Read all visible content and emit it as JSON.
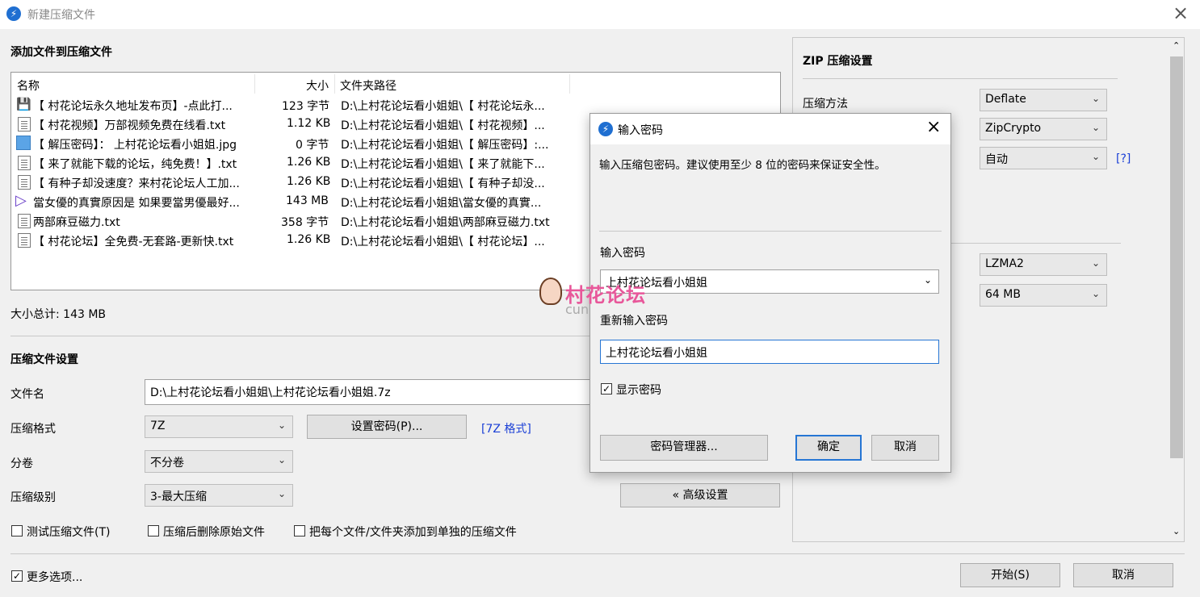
{
  "window": {
    "title": "新建压缩文件",
    "close_icon": "×"
  },
  "files_section": {
    "title": "添加文件到压缩文件",
    "columns": {
      "name": "名称",
      "size": "大小",
      "path": "文件夹路径"
    },
    "rows": [
      {
        "icon": "floppy-icon",
        "name": "【 村花论坛永久地址发布页】-点此打...",
        "size": "123 字节",
        "path": "D:\\上村花论坛看小姐姐\\【 村花论坛永..."
      },
      {
        "icon": "text-file-icon",
        "name": "【 村花视频】万部视频免费在线看.txt",
        "size": "1.12 KB",
        "path": "D:\\上村花论坛看小姐姐\\【 村花视频】..."
      },
      {
        "icon": "image-file-icon",
        "name": "【 解压密码】： 上村花论坛看小姐姐.jpg",
        "size": "0 字节",
        "path": "D:\\上村花论坛看小姐姐\\【 解压密码】:..."
      },
      {
        "icon": "text-file-icon",
        "name": "【 来了就能下载的论坛，纯免费！】.txt",
        "size": "1.26 KB",
        "path": "D:\\上村花论坛看小姐姐\\【 来了就能下..."
      },
      {
        "icon": "text-file-icon",
        "name": "【 有种子却没速度？来村花论坛人工加...",
        "size": "1.26 KB",
        "path": "D:\\上村花论坛看小姐姐\\【 有种子却没..."
      },
      {
        "icon": "video-file-icon",
        "name": "當女優的真實原因是 如果要當男優最好...",
        "size": "143 MB",
        "path": "D:\\上村花论坛看小姐姐\\當女優的真實..."
      },
      {
        "icon": "text-file-icon",
        "name": "两部麻豆磁力.txt",
        "size": "358 字节",
        "path": "D:\\上村花论坛看小姐姐\\两部麻豆磁力.txt"
      },
      {
        "icon": "text-file-icon",
        "name": "【 村花论坛】全免费-无套路-更新快.txt",
        "size": "1.26 KB",
        "path": "D:\\上村花论坛看小姐姐\\【 村花论坛】..."
      }
    ],
    "total": "大小总计: 143 MB"
  },
  "archive_settings": {
    "title": "压缩文件设置",
    "filename_label": "文件名",
    "filename_value": "D:\\上村花论坛看小姐姐\\上村花论坛看小姐姐.7z",
    "format_label": "压缩格式",
    "format_value": "7Z",
    "set_password_button": "设置密码(P)...",
    "format_link": "[7Z 格式]",
    "split_label": "分卷",
    "split_value": "不分卷",
    "level_label": "压缩级别",
    "level_value": "3-最大压缩",
    "advanced_button": "« 高级设置",
    "test_checkbox": "测试压缩文件(T)",
    "delete_checkbox": "压缩后删除原始文件",
    "separate_checkbox": "把每个文件/文件夹添加到单独的压缩文件",
    "more_options": "更多选项...",
    "start_button": "开始(S)",
    "cancel_button": "取消"
  },
  "zip_panel": {
    "title": "ZIP 压缩设置",
    "method_label": "压缩方法",
    "method_value": "Deflate",
    "encryption_value": "ZipCrypto",
    "auto_value": "自动",
    "help_link": "[?]",
    "lzma_value": "LZMA2",
    "dict_value": "64 MB"
  },
  "password_dialog": {
    "title": "输入密码",
    "description": "输入压缩包密码。建议使用至少 8 位的密码来保证安全性。",
    "password_label": "输入密码",
    "password_value": "上村花论坛看小姐姐",
    "confirm_label": "重新输入密码",
    "confirm_value": "上村花论坛看小姐姐",
    "show_password": "显示密码",
    "manager_button": "密码管理器...",
    "ok_button": "确定",
    "cancel_button": "取消"
  },
  "watermark": {
    "text": "村花论坛",
    "sub": "cun"
  },
  "colors": {
    "accent": "#2676d4",
    "link": "#1a3fd6",
    "watermark": "#e8579a"
  }
}
